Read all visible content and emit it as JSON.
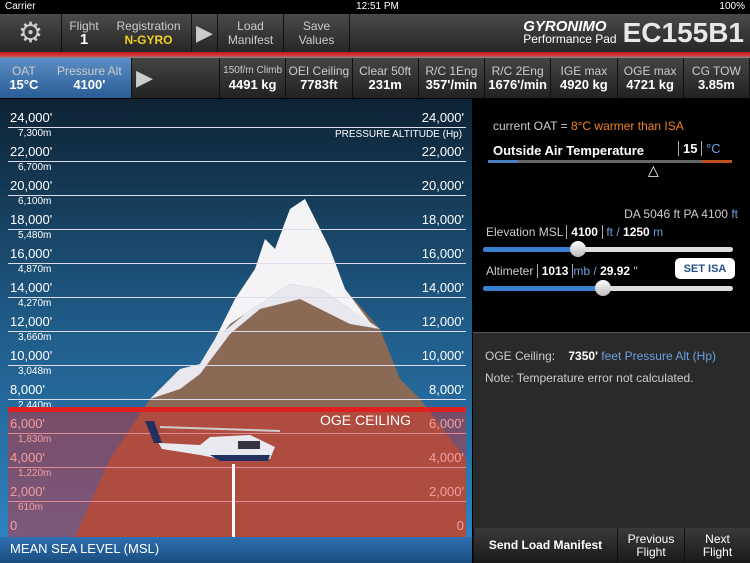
{
  "status": {
    "carrier": "Carrier",
    "time": "12:51 PM",
    "battery": "100%"
  },
  "header": {
    "flight_label": "Flight",
    "flight": "1",
    "registration_label": "Registration",
    "registration": "N-GYRO",
    "load_manifest": "Load Manifest",
    "save_values": "Save Values",
    "brand": "GYRONIMO",
    "brand_sub": "Performance Pad",
    "model": "EC155B1"
  },
  "summary": {
    "oat_label": "OAT",
    "oat": "15°C",
    "pa_label": "Pressure Alt",
    "pa": "4100'",
    "items": [
      {
        "label": "150f/m Climb",
        "value": "4491 kg"
      },
      {
        "label": "OEI Ceiling",
        "value": "7783ft"
      },
      {
        "label": "Clear 50ft",
        "value": "231m"
      },
      {
        "label": "R/C 1Eng",
        "value": "357'/min"
      },
      {
        "label": "R/C 2Eng",
        "value": "1676'/min"
      },
      {
        "label": "IGE max",
        "value": "4920 kg"
      },
      {
        "label": "OGE max",
        "value": "4721 kg"
      },
      {
        "label": "CG TOW",
        "value": "3.85m"
      }
    ]
  },
  "chart": {
    "ft_labels": [
      "24,000'",
      "22,000'",
      "20,000'",
      "18,000'",
      "16,000'",
      "14,000'",
      "12,000'",
      "10,000'",
      "8,000'",
      "6,000'",
      "4,000'",
      "2,000'",
      "0"
    ],
    "m_labels": [
      "7,300m",
      "6,700m",
      "6,100m",
      "5,480m",
      "4,870m",
      "4,270m",
      "3,660m",
      "3,048m",
      "2,440m",
      "1,830m",
      "1,220m",
      "610m"
    ],
    "pa_title": "PRESSURE ALTITUDE (Hp)",
    "oge_label": "OGE CEILING",
    "oge_ceiling_ft": 7350,
    "msl_label": "MEAN SEA LEVEL (MSL)",
    "colors": {
      "oge": "#e02020"
    }
  },
  "panel": {
    "oat_prefix": "current OAT =",
    "oat_diff": "8°C warmer than ISA",
    "oat_title": "Outside Air Temperature",
    "oat_value": "15",
    "oat_unit": "°C",
    "da_label": "DA",
    "da": "5046 ft",
    "pa_label": "PA",
    "pa": "4100",
    "pa_unit": "ft",
    "elev_label": "Elevation MSL",
    "elev_ft": "4100",
    "ft": "ft",
    "slash": "/",
    "elev_m": "1250",
    "m": "m",
    "elev_slider": 0.38,
    "alt_label": "Altimeter",
    "alt_mb": "1013",
    "mb": "mb /",
    "alt_in": "29.92",
    "inch": "\"",
    "alt_slider": 0.48,
    "set_isa": "SET ISA",
    "oge_label": "OGE Ceiling:",
    "oge": "7350'",
    "oge_unit": "feet Pressure Alt (Hp)",
    "note": "Note: Temperature error not calculated."
  },
  "footer": {
    "send": "Send Load Manifest",
    "prev": "Previous Flight",
    "next": "Next Flight"
  }
}
